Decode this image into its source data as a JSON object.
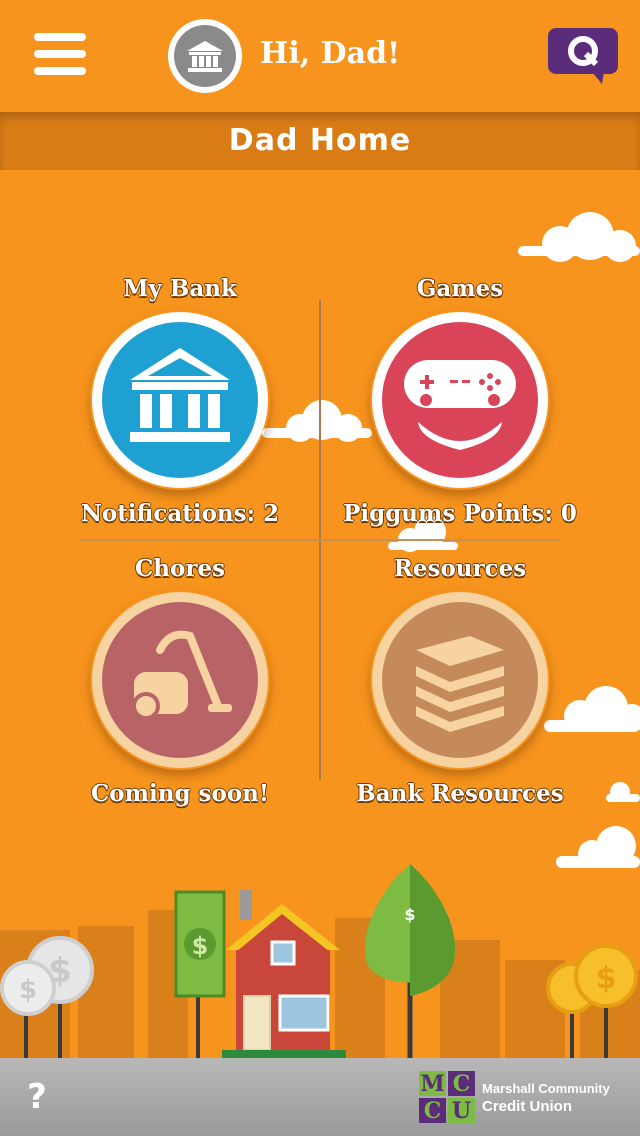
{
  "header": {
    "greeting": "Hi, Dad!",
    "page_title": "Dad Home",
    "menu_icon": "hamburger-menu-icon",
    "avatar_icon": "bank-building-icon",
    "chat_icon": "q-chat-bubble-icon"
  },
  "tiles": [
    {
      "title": "My Bank",
      "caption": "Notifications: 2",
      "icon": "bank-building-icon",
      "color": "#1fa0d2"
    },
    {
      "title": "Games",
      "caption": "Piggums Points: 0",
      "icon": "gamepad-smile-icon",
      "color": "#d94458"
    },
    {
      "title": "Chores",
      "caption": "Coming soon!",
      "icon": "vacuum-cleaner-icon",
      "color": "#b86466"
    },
    {
      "title": "Resources",
      "caption": "Bank Resources",
      "icon": "book-stack-icon",
      "color": "#c58a5a"
    }
  ],
  "footer": {
    "help_label": "?",
    "logo_letters": [
      "M",
      "C",
      "C",
      "U"
    ],
    "logo_line1": "Marshall Community",
    "logo_line2": "Credit Union"
  },
  "colors": {
    "background": "#f7941d",
    "subheader": "#d97c15",
    "footer": "#a8a8a8",
    "chat_button": "#5b2c7a"
  }
}
